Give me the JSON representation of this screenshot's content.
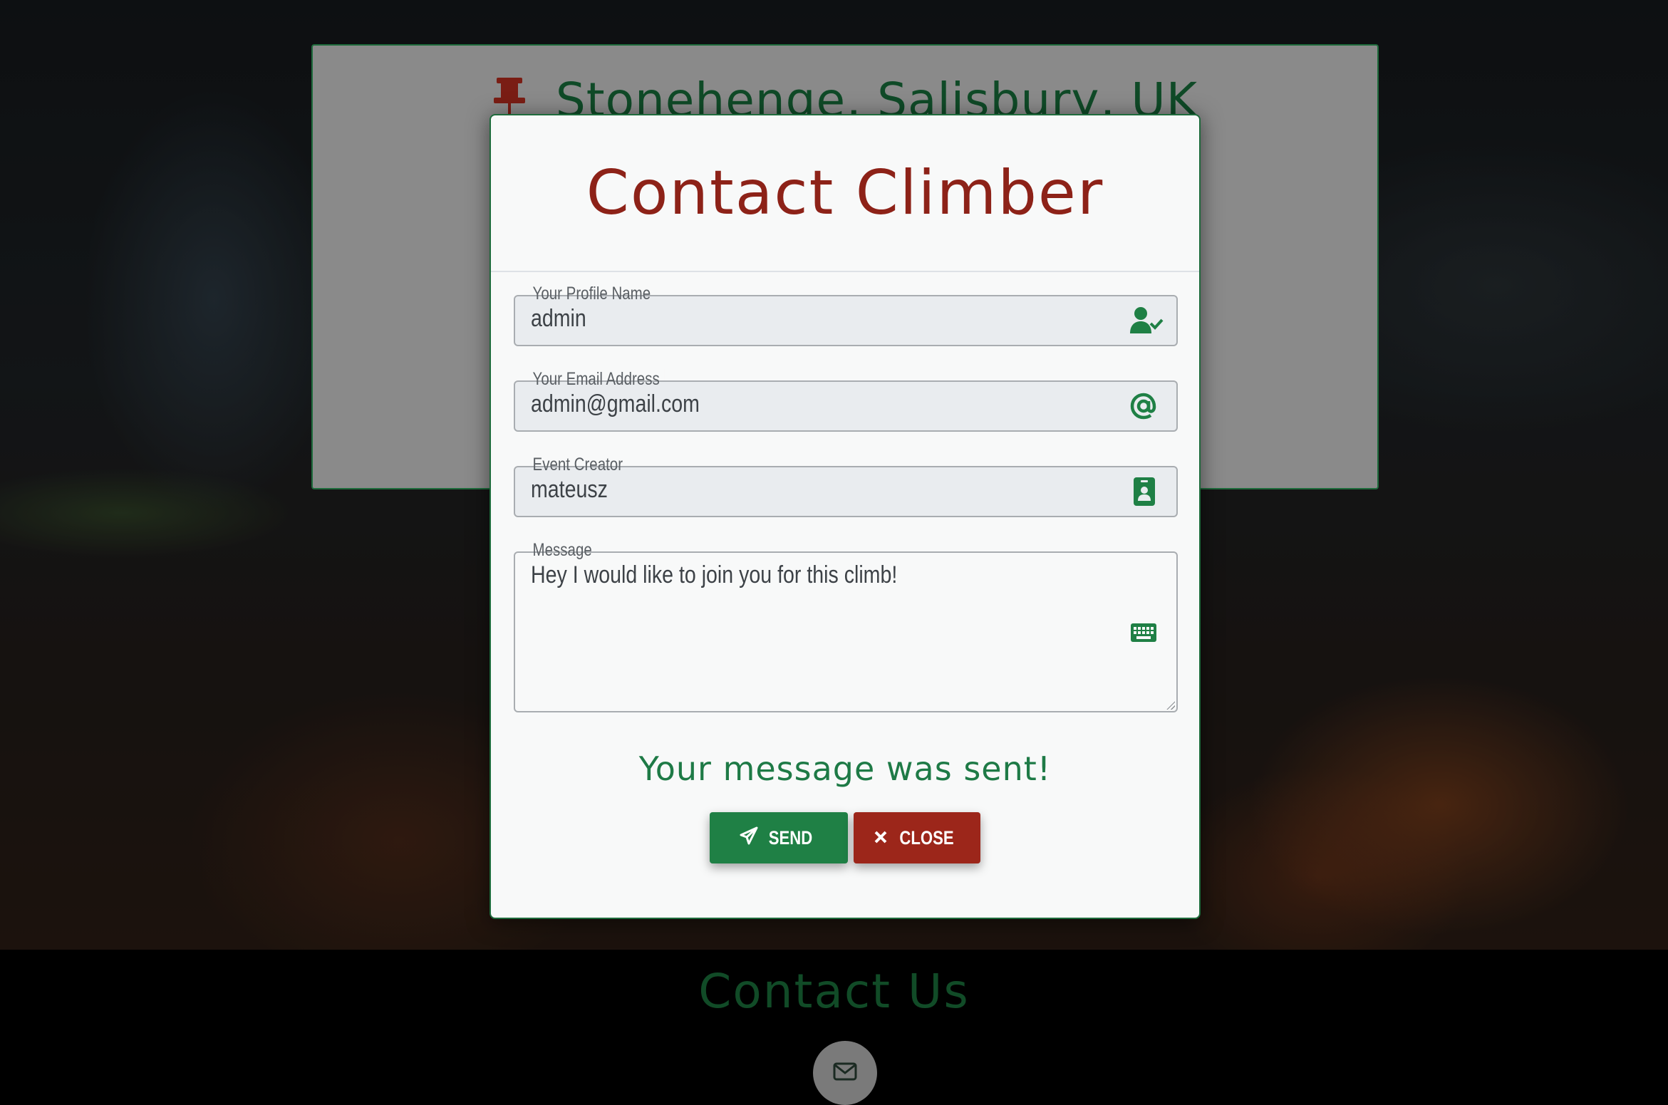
{
  "event": {
    "title": "Stonehenge, Salisbury, UK"
  },
  "modal": {
    "title": "Contact Climber",
    "fields": {
      "profile_name": {
        "label": "Your Profile Name",
        "value": "admin"
      },
      "email": {
        "label": "Your Email Address",
        "value": "admin@gmail.com"
      },
      "creator": {
        "label": "Event Creator",
        "value": "mateusz"
      },
      "message": {
        "label": "Message",
        "value": "Hey I would like to join you for this climb!"
      }
    },
    "status": "Your message was sent!",
    "buttons": {
      "send": "SEND",
      "close": "CLOSE"
    }
  },
  "footer": {
    "title": "Contact Us"
  },
  "icons": {
    "pin": "thumbtack-icon",
    "user_check": "user-check-icon",
    "at": "at-icon",
    "id_badge": "id-badge-icon",
    "keyboard": "keyboard-icon",
    "paper_plane": "paper-plane-icon",
    "times": "times-icon",
    "envelope": "envelope-icon"
  },
  "colors": {
    "brand_green": "#1f8045",
    "brand_red": "#9c261a",
    "title_red": "#8d2218",
    "status_green": "#1e7a46"
  }
}
